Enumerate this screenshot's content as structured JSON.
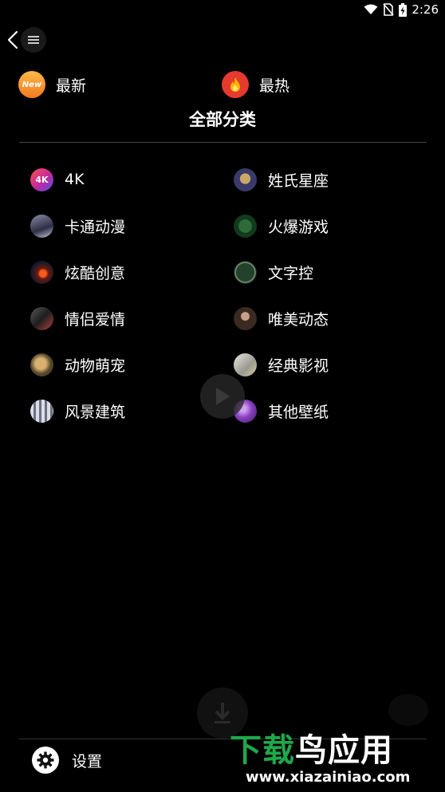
{
  "status_bar": {
    "time": "2:26"
  },
  "quick_links": [
    {
      "label": "最新",
      "badge": "New"
    },
    {
      "label": "最热"
    }
  ],
  "section_title": "全部分类",
  "categories": [
    {
      "label": "4K",
      "thumb_text": "4K"
    },
    {
      "label": "姓氏星座"
    },
    {
      "label": "卡通动漫"
    },
    {
      "label": "火爆游戏"
    },
    {
      "label": "炫酷创意"
    },
    {
      "label": "文字控"
    },
    {
      "label": "情侣爱情"
    },
    {
      "label": "唯美动态"
    },
    {
      "label": "动物萌宠"
    },
    {
      "label": "经典影视"
    },
    {
      "label": "风景建筑"
    },
    {
      "label": "其他壁纸"
    }
  ],
  "settings": {
    "label": "设置"
  },
  "watermark": {
    "title_green": "下载",
    "title_white": "鸟应用",
    "url": "www.xiazainiao.com"
  },
  "colors": {
    "background": "#000000",
    "divider": "#444444",
    "watermark_green": "#1fa84a",
    "hot_icon": "#e53a2e",
    "new_icon": "#f5a030"
  }
}
